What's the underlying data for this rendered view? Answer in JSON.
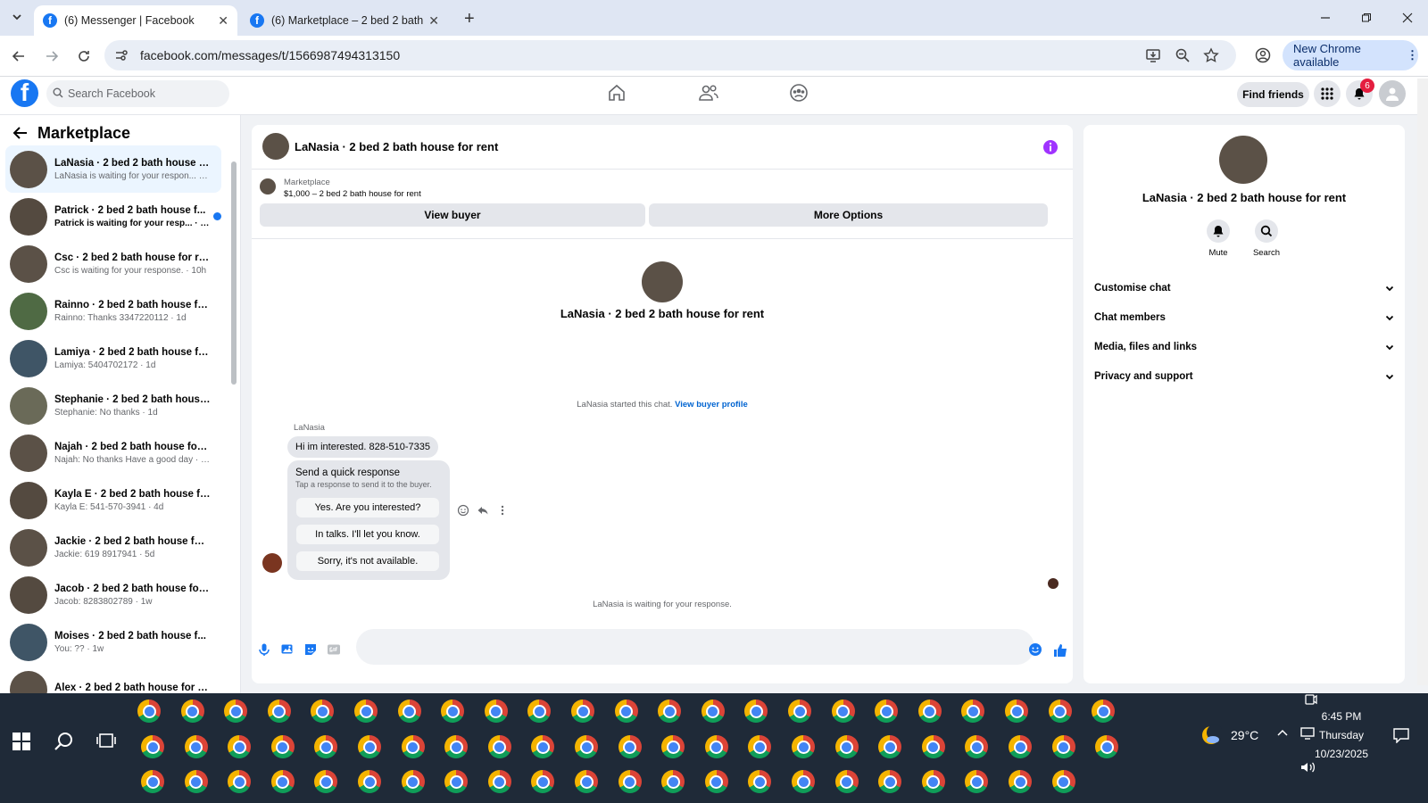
{
  "browser": {
    "tabs": [
      {
        "label": "(6) Messenger | Facebook",
        "active": true
      },
      {
        "label": "(6) Marketplace – 2 bed 2 bath",
        "active": false
      }
    ],
    "new_tab": "+",
    "url": "facebook.com/messages/t/1566987494313150",
    "update_label": "New Chrome available"
  },
  "fb": {
    "search_placeholder": "Search Facebook",
    "find_friends": "Find friends",
    "notification_count": "6"
  },
  "sidebar": {
    "title": "Marketplace",
    "conversations": [
      {
        "name": "LaNasia · 2 bed 2 bath house fo...",
        "preview": "LaNasia is waiting for your respon... · 8h",
        "selected": true,
        "unread": false,
        "avatar": "#5b5147"
      },
      {
        "name": "Patrick · 2 bed 2 bath house f...",
        "preview": "Patrick is waiting for your resp... · 9h",
        "selected": false,
        "unread": true,
        "avatar": "#544a40"
      },
      {
        "name": "Csc · 2 bed 2 bath house for rent",
        "preview": "Csc is waiting for your response. · 10h",
        "selected": false,
        "unread": false,
        "avatar": "#5b5147"
      },
      {
        "name": "Rainno · 2 bed 2 bath house for...",
        "preview": "Rainno: Thanks 3347220112 · 1d",
        "selected": false,
        "unread": false,
        "avatar": "#4f6a44"
      },
      {
        "name": "Lamiya · 2 bed 2 bath house for...",
        "preview": "Lamiya: 5404702172 · 1d",
        "selected": false,
        "unread": false,
        "avatar": "#3f5566"
      },
      {
        "name": "Stephanie · 2 bed 2 bath house ...",
        "preview": "Stephanie: No thanks · 1d",
        "selected": false,
        "unread": false,
        "avatar": "#6a6a58"
      },
      {
        "name": "Najah · 2 bed 2 bath house for ...",
        "preview": "Najah: No thanks Have a good day · 4d",
        "selected": false,
        "unread": false,
        "avatar": "#5b5147"
      },
      {
        "name": "Kayla E · 2 bed 2 bath house for...",
        "preview": "Kayla E: 541-570-3941 · 4d",
        "selected": false,
        "unread": false,
        "avatar": "#544a40"
      },
      {
        "name": "Jackie · 2 bed 2 bath house for ...",
        "preview": "Jackie: 619 8917941 · 5d",
        "selected": false,
        "unread": false,
        "avatar": "#5b5147"
      },
      {
        "name": "Jacob · 2 bed 2 bath house for r...",
        "preview": "Jacob: 8283802789 · 1w",
        "selected": false,
        "unread": false,
        "avatar": "#544a40"
      },
      {
        "name": "Moises · 2 bed 2 bath house f...",
        "preview": "You: ?? · 1w",
        "selected": false,
        "unread": false,
        "avatar": "#3f5566"
      },
      {
        "name": "Alex · 2 bed 2 bath house for rent",
        "preview": "",
        "selected": false,
        "unread": false,
        "avatar": "#5b5147"
      }
    ]
  },
  "chat": {
    "title": "LaNasia · 2 bed 2 bath house for rent",
    "marketplace_label": "Marketplace",
    "listing": "$1,000 – 2 bed 2 bath house for rent",
    "view_buyer": "View buyer",
    "more_options": "More Options",
    "profile_name": "LaNasia · 2 bed 2 bath house for rent",
    "started_text": "LaNasia started this chat.",
    "view_buyer_profile": "View buyer profile",
    "sender": "LaNasia",
    "message": "Hi im interested. 828-510-7335",
    "quick_title": "Send a quick response",
    "quick_sub": "Tap a response to send it to the buyer.",
    "quick_responses": [
      "Yes. Are you interested?",
      "In talks. I'll let you know.",
      "Sorry, it's not available."
    ],
    "waiting_text": "LaNasia is waiting for your response."
  },
  "details": {
    "name": "LaNasia · 2 bed 2 bath house for rent",
    "mute": "Mute",
    "search": "Search",
    "sections": [
      "Customise chat",
      "Chat members",
      "Media, files and links",
      "Privacy and support"
    ]
  },
  "taskbar": {
    "temperature": "29°C",
    "time": "6:45 PM",
    "day": "Thursday",
    "date": "10/23/2025"
  },
  "colors": {
    "brand": "#1877f2",
    "accent_purple": "#a033ff",
    "selected_row": "#ebf5ff"
  }
}
